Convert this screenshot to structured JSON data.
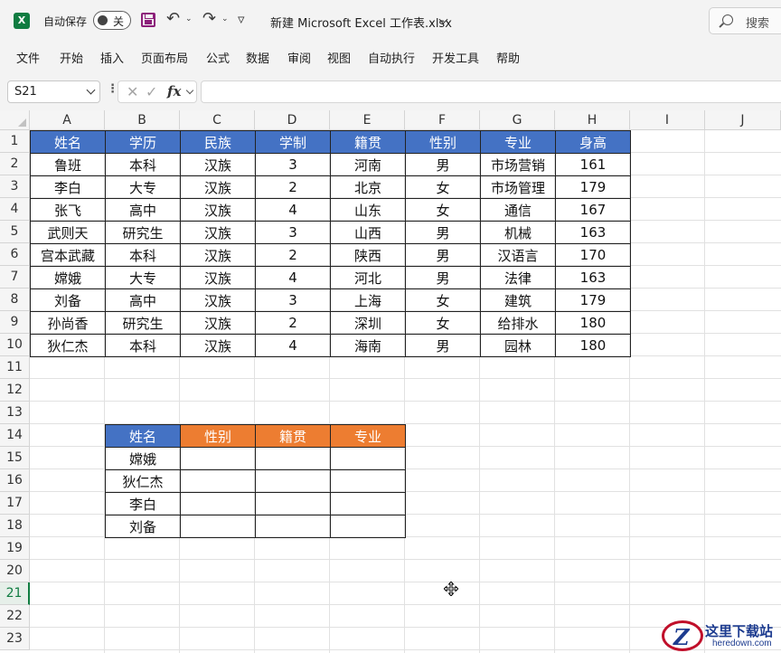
{
  "titlebar": {
    "app_icon": "excel-logo",
    "autosave_label": "自动保存",
    "autosave_state": "关",
    "doc_title": "新建 Microsoft Excel 工作表.xlsx",
    "search_label": "搜索"
  },
  "menu": [
    "文件",
    "开始",
    "插入",
    "页面布局",
    "公式",
    "数据",
    "审阅",
    "视图",
    "自动执行",
    "开发工具",
    "帮助"
  ],
  "formula_bar": {
    "name_box": "S21",
    "formula": ""
  },
  "columns": [
    "A",
    "B",
    "C",
    "D",
    "E",
    "F",
    "G",
    "H",
    "I",
    "J"
  ],
  "rows": [
    "1",
    "2",
    "3",
    "4",
    "5",
    "6",
    "7",
    "8",
    "9",
    "10",
    "11",
    "12",
    "13",
    "14",
    "15",
    "16",
    "17",
    "18",
    "19",
    "20",
    "21",
    "22",
    "23"
  ],
  "active_row": "21",
  "table1": {
    "headers": [
      "姓名",
      "学历",
      "民族",
      "学制",
      "籍贯",
      "性别",
      "专业",
      "身高"
    ],
    "rows": [
      [
        "鲁班",
        "本科",
        "汉族",
        "3",
        "河南",
        "男",
        "市场营销",
        "161"
      ],
      [
        "李白",
        "大专",
        "汉族",
        "2",
        "北京",
        "女",
        "市场管理",
        "179"
      ],
      [
        "张飞",
        "高中",
        "汉族",
        "4",
        "山东",
        "女",
        "通信",
        "167"
      ],
      [
        "武则天",
        "研究生",
        "汉族",
        "3",
        "山西",
        "男",
        "机械",
        "163"
      ],
      [
        "宫本武藏",
        "本科",
        "汉族",
        "2",
        "陕西",
        "男",
        "汉语言",
        "170"
      ],
      [
        "嫦娥",
        "大专",
        "汉族",
        "4",
        "河北",
        "男",
        "法律",
        "163"
      ],
      [
        "刘备",
        "高中",
        "汉族",
        "3",
        "上海",
        "女",
        "建筑",
        "179"
      ],
      [
        "孙尚香",
        "研究生",
        "汉族",
        "2",
        "深圳",
        "女",
        "给排水",
        "180"
      ],
      [
        "狄仁杰",
        "本科",
        "汉族",
        "4",
        "海南",
        "男",
        "园林",
        "180"
      ]
    ]
  },
  "table2": {
    "headers": [
      "姓名",
      "性别",
      "籍贯",
      "专业"
    ],
    "names": [
      "嫦娥",
      "狄仁杰",
      "李白",
      "刘备"
    ]
  },
  "watermark": {
    "text": "这里下载站",
    "sub": "heredown.com"
  },
  "colors": {
    "header_blue": "#4472c4",
    "header_orange": "#ed7d31",
    "excel_green": "#107c41"
  }
}
